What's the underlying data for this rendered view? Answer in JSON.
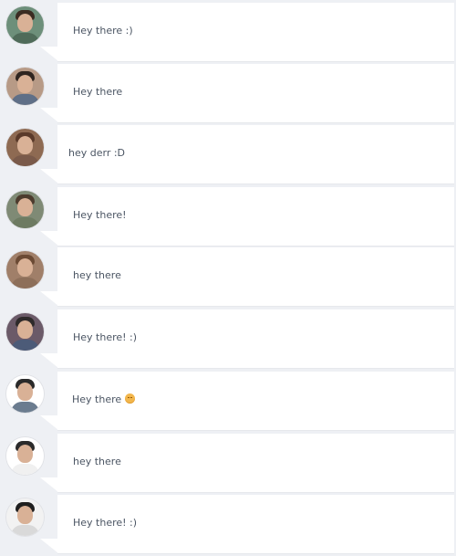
{
  "messages": [
    {
      "text": "Hey there :)",
      "avatar_icon": "user-avatar",
      "bg": "#6d8f7a",
      "hair": "#3b2c22",
      "shirt": "#4f6b59",
      "emoji": false
    },
    {
      "text": "Hey there",
      "avatar_icon": "user-avatar",
      "bg": "#b79a86",
      "hair": "#2f2520",
      "shirt": "#5f6f87",
      "emoji": false
    },
    {
      "text": "hey derr :D",
      "avatar_icon": "user-avatar",
      "bg": "#8e6a52",
      "hair": "#5a3a2a",
      "shirt": "#7a5a4a",
      "emoji": false
    },
    {
      "text": "Hey there!",
      "avatar_icon": "user-avatar",
      "bg": "#7f8a75",
      "hair": "#4c3b2d",
      "shirt": "#6e7b62",
      "emoji": false
    },
    {
      "text": "hey there",
      "avatar_icon": "user-avatar",
      "bg": "#a07f69",
      "hair": "#6b4a34",
      "shirt": "#8d6f5a",
      "emoji": false
    },
    {
      "text": "Hey there! :)",
      "avatar_icon": "user-avatar",
      "bg": "#6b5a68",
      "hair": "#2e2a2a",
      "shirt": "#4c5b78",
      "emoji": false
    },
    {
      "text": "Hey there",
      "avatar_icon": "user-avatar",
      "bg": "#ffffff",
      "hair": "#2a2a2a",
      "shirt": "#6b7c8f",
      "emoji": true,
      "emoji_icon": "smiling-face-emoji"
    },
    {
      "text": "hey there",
      "avatar_icon": "user-avatar",
      "bg": "#ffffff",
      "hair": "#2b2b2b",
      "shirt": "#f0f0f0",
      "emoji": false
    },
    {
      "text": "Hey there! :)",
      "avatar_icon": "user-avatar",
      "bg": "#f2f2f2",
      "hair": "#1f1f1f",
      "shirt": "#d9d9d9",
      "emoji": false
    }
  ]
}
